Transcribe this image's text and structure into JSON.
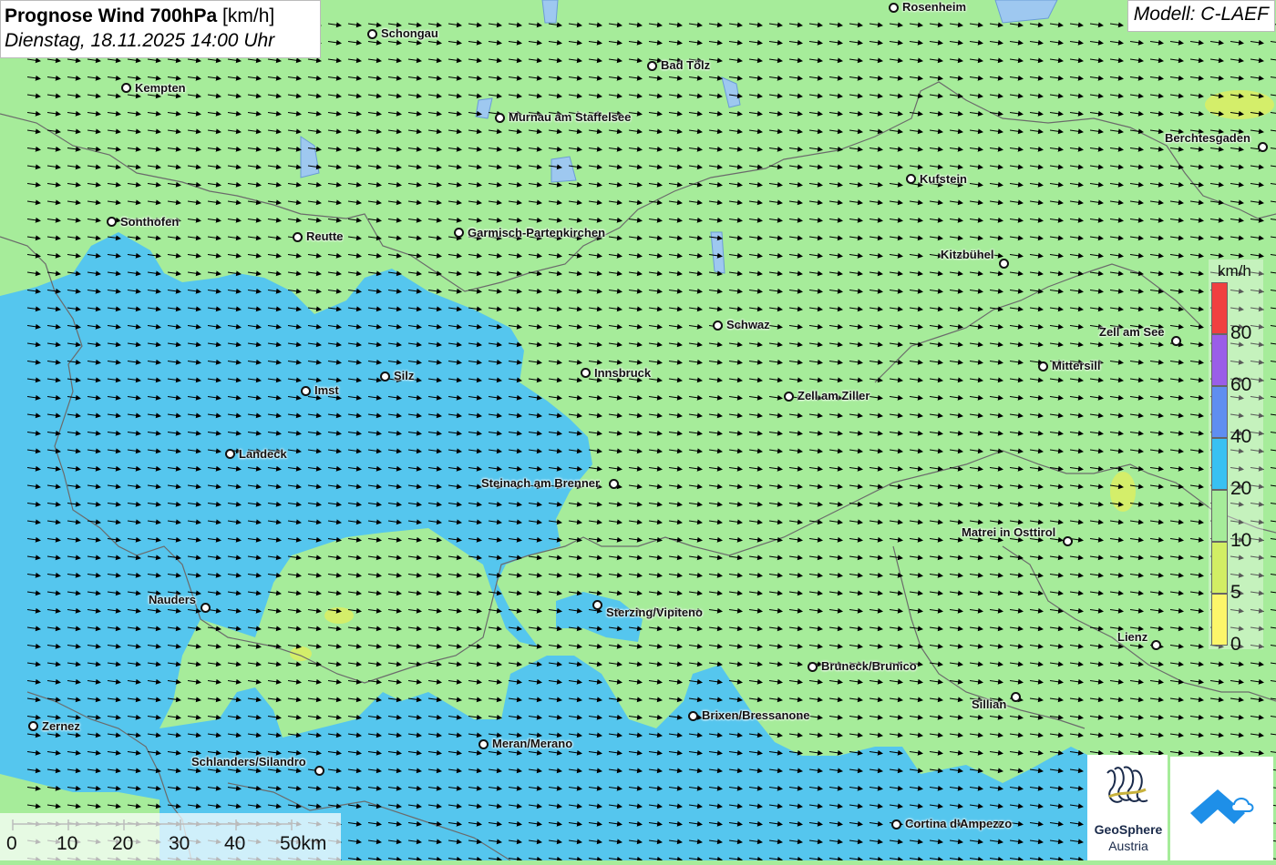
{
  "title": {
    "main": "Prognose Wind 700hPa",
    "unit": "[km/h]",
    "datetime": "Dienstag, 18.11.2025 14:00 Uhr"
  },
  "model": "Modell: C-LAEF",
  "colors": {
    "land_green": "#a6ec9a",
    "wind_blue": "#55c6ee",
    "yellow_green": "#d4ee6a",
    "border": "#6b6b6b",
    "lake": "#9ec8f0"
  },
  "cities": [
    {
      "name": "Rosenheim"
    },
    {
      "name": "Schongau"
    },
    {
      "name": "Kempten"
    },
    {
      "name": "Bad Tölz"
    },
    {
      "name": "Murnau am Staffelsee"
    },
    {
      "name": "Berchtesgaden"
    },
    {
      "name": "Kufstein"
    },
    {
      "name": "Sonthofen"
    },
    {
      "name": "Reutte"
    },
    {
      "name": "Garmisch-Partenkirchen"
    },
    {
      "name": "Kitzbühel"
    },
    {
      "name": "Schwaz"
    },
    {
      "name": "Zell am See"
    },
    {
      "name": "Mittersill"
    },
    {
      "name": "Silz"
    },
    {
      "name": "Innsbruck"
    },
    {
      "name": "Imst"
    },
    {
      "name": "Zell am Ziller"
    },
    {
      "name": "Landeck"
    },
    {
      "name": "Steinach am Brenner"
    },
    {
      "name": "Matrei in Osttirol"
    },
    {
      "name": "Nauders"
    },
    {
      "name": "Sterzing/Vipiteno"
    },
    {
      "name": "Lienz"
    },
    {
      "name": "Bruneck/Brunico"
    },
    {
      "name": "Sillian"
    },
    {
      "name": "Zernez"
    },
    {
      "name": "Brixen/Bressanone"
    },
    {
      "name": "Meran/Merano"
    },
    {
      "name": "Schlanders/Silandro"
    },
    {
      "name": "Cortina d'Ampezzo"
    }
  ],
  "legend": {
    "unit": "km/h",
    "ticks": [
      "80",
      "60",
      "40",
      "20",
      "10",
      "5",
      "0"
    ],
    "colors": [
      "#f04040",
      "#9a5ee8",
      "#5f8ef0",
      "#38c1f2",
      "#a6ec9a",
      "#d2ee64",
      "#fcf66a"
    ]
  },
  "scalebar": {
    "labels": [
      "0",
      "10",
      "20",
      "30",
      "40",
      "50km"
    ]
  },
  "logos": {
    "geosphere_line1": "GeoSphere",
    "geosphere_line2": "Austria"
  },
  "wind": {
    "direction": "east-southeast",
    "speed_range_kmh": [
      5,
      20
    ]
  }
}
